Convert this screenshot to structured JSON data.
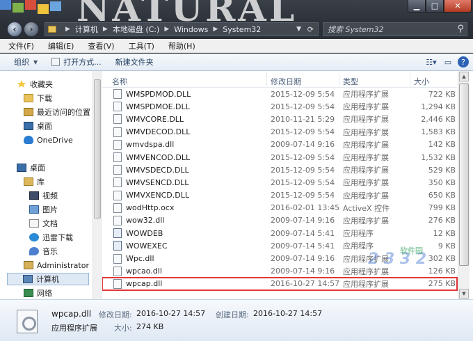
{
  "window": {
    "background_title": "NATURAL",
    "controls": {
      "minimize": "▁",
      "maximize": "□",
      "close": "✕"
    }
  },
  "address": {
    "crumbs": [
      "计算机",
      "本地磁盘 (C:)",
      "Windows",
      "System32"
    ],
    "search_placeholder": "搜索 System32"
  },
  "menu": [
    "文件(F)",
    "编辑(E)",
    "查看(V)",
    "工具(T)",
    "帮助(H)"
  ],
  "toolbar": {
    "organize": "组织",
    "open_with": "打开方式...",
    "new_folder": "新建文件夹"
  },
  "nav": {
    "favorites": "收藏夹",
    "downloads": "下载",
    "recent": "最近访问的位置",
    "desktop": "桌面",
    "onedrive": "OneDrive",
    "desktop2": "桌面",
    "libraries": "库",
    "videos": "视频",
    "pictures": "图片",
    "documents": "文档",
    "thunder": "迅雷下载",
    "music": "音乐",
    "admin": "Administrator",
    "computer": "计算机",
    "network": "网络"
  },
  "columns": {
    "name": "名称",
    "modified": "修改日期",
    "type": "类型",
    "size": "大小"
  },
  "files": [
    {
      "name": "WMSPDMOD.DLL",
      "date": "2015-12-09 5:54",
      "type": "应用程序扩展",
      "size": "722 KB"
    },
    {
      "name": "WMSPDMOE.DLL",
      "date": "2015-12-09 5:54",
      "type": "应用程序扩展",
      "size": "1,294 KB"
    },
    {
      "name": "WMVCORE.DLL",
      "date": "2010-11-21 5:29",
      "type": "应用程序扩展",
      "size": "2,446 KB"
    },
    {
      "name": "WMVDECOD.DLL",
      "date": "2015-12-09 5:54",
      "type": "应用程序扩展",
      "size": "1,583 KB"
    },
    {
      "name": "wmvdspa.dll",
      "date": "2009-07-14 9:16",
      "type": "应用程序扩展",
      "size": "142 KB"
    },
    {
      "name": "WMVENCOD.DLL",
      "date": "2015-12-09 5:54",
      "type": "应用程序扩展",
      "size": "1,532 KB"
    },
    {
      "name": "WMVSDECD.DLL",
      "date": "2015-12-09 5:54",
      "type": "应用程序扩展",
      "size": "529 KB"
    },
    {
      "name": "WMVSENCD.DLL",
      "date": "2015-12-09 5:54",
      "type": "应用程序扩展",
      "size": "350 KB"
    },
    {
      "name": "WMVXENCD.DLL",
      "date": "2015-12-09 5:54",
      "type": "应用程序扩展",
      "size": "650 KB"
    },
    {
      "name": "wodHttp.ocx",
      "date": "2016-02-01 13:45",
      "type": "ActiveX 控件",
      "size": "799 KB"
    },
    {
      "name": "wow32.dll",
      "date": "2009-07-14 9:16",
      "type": "应用程序扩展",
      "size": "276 KB"
    },
    {
      "name": "WOWDEB",
      "date": "2009-07-14 5:41",
      "type": "应用程序",
      "size": "12 KB"
    },
    {
      "name": "WOWEXEC",
      "date": "2009-07-14 5:41",
      "type": "应用程序",
      "size": "9 KB"
    },
    {
      "name": "Wpc.dll",
      "date": "2009-07-14 9:16",
      "type": "应用程序扩展",
      "size": "302 KB"
    },
    {
      "name": "wpcao.dll",
      "date": "2009-07-14 9:16",
      "type": "应用程序扩展",
      "size": "126 KB"
    },
    {
      "name": "wpcap.dll",
      "date": "2016-10-27 14:57",
      "type": "应用程序扩展",
      "size": "275 KB"
    }
  ],
  "watermark": {
    "main": "2 3 3 2",
    "sub": "软件园"
  },
  "details": {
    "filename": "wpcap.dll",
    "type": "应用程序扩展",
    "modified_label": "修改日期:",
    "modified_value": "2016-10-27 14:57",
    "created_label": "创建日期:",
    "created_value": "2016-10-27 14:57",
    "size_label": "大小:",
    "size_value": "274 KB"
  }
}
